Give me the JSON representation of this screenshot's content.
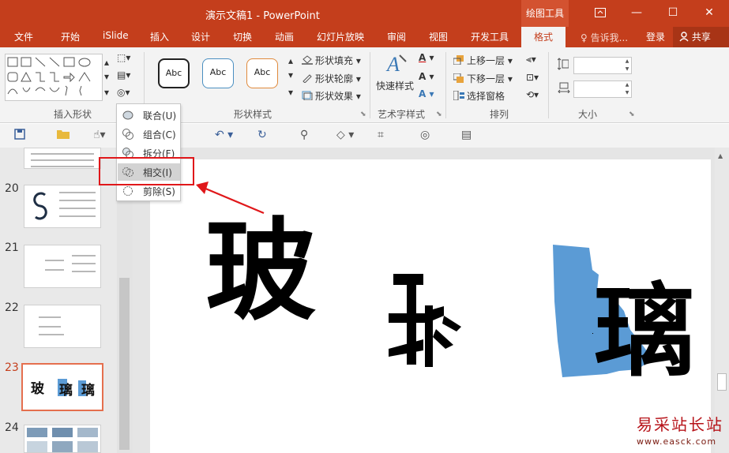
{
  "window": {
    "title": "演示文稿1 - PowerPoint",
    "context_tab": "绘图工具",
    "controls": {
      "restore_icon": "ribbon-display-icon",
      "minimize": "—",
      "maximize": "☐",
      "close": "✕"
    }
  },
  "tabs": [
    "文件",
    "开始",
    "iSlide",
    "插入",
    "设计",
    "切换",
    "动画",
    "幻灯片放映",
    "审阅",
    "视图",
    "开发工具",
    "格式"
  ],
  "active_tab": "格式",
  "tell_me": "告诉我...",
  "login": "登录",
  "share": "共享",
  "ribbon": {
    "insert_shapes": {
      "label": "插入形状"
    },
    "shape_styles": {
      "label": "形状样式",
      "samples": [
        "Abc",
        "Abc",
        "Abc"
      ],
      "fill": "形状填充",
      "outline": "形状轮廓",
      "effects": "形状效果"
    },
    "wordart": {
      "label": "艺术字样式",
      "quick_styles": "快速样式"
    },
    "arrange": {
      "label": "排列",
      "bring_forward": "上移一层",
      "send_backward": "下移一层",
      "selection_pane": "选择窗格"
    },
    "size": {
      "label": "大小"
    }
  },
  "merge_menu": {
    "items": [
      {
        "label": "联合(U)"
      },
      {
        "label": "组合(C)"
      },
      {
        "label": "拆分(F)"
      },
      {
        "label": "相交(I)"
      },
      {
        "label": "剪除(S)"
      }
    ],
    "highlighted": "相交(I)"
  },
  "slides": {
    "numbers": [
      "20",
      "21",
      "22",
      "23",
      "24"
    ],
    "selected": "23",
    "thumb23_chars": [
      "玻",
      "璃",
      "璃"
    ]
  },
  "slide_content": {
    "char1": "玻",
    "char2": "璃",
    "char3": "璃",
    "shape_color": "#5b9bd5"
  },
  "watermark": {
    "cn": "易采站长站",
    "url": "www.easck.com"
  },
  "colors": {
    "accent": "#c43e1c",
    "highlight": "#e0171a"
  }
}
